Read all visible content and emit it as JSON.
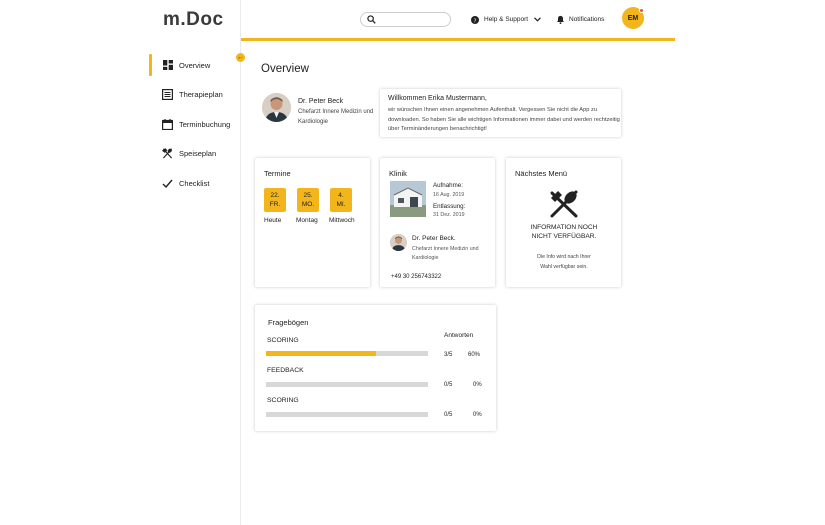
{
  "app": {
    "logo": "m.Doc"
  },
  "sidebar": {
    "items": [
      {
        "label": "Overview",
        "icon": "dashboard-icon",
        "active": true
      },
      {
        "label": "Therapieplan",
        "icon": "list-icon"
      },
      {
        "label": "Terminbuchung",
        "icon": "calendar-icon"
      },
      {
        "label": "Speiseplan",
        "icon": "cutlery-icon"
      },
      {
        "label": "Checklist",
        "icon": "check-icon"
      }
    ],
    "collapse_icon": "arrow-left-icon"
  },
  "header": {
    "search": {
      "placeholder": "",
      "icon": "search-icon"
    },
    "help_label": "Help & Support",
    "notifications_label": "Notifications",
    "avatar_initials": "EM"
  },
  "colors": {
    "accent": "#f2b51b",
    "badge": "#e85040"
  },
  "page": {
    "title": "Overview"
  },
  "doctor": {
    "name": "Dr. Peter Beck",
    "role": "Chefarzt Innere Medizin und Kardiologie"
  },
  "welcome": {
    "title": "Willkommen Erika Mustermann,",
    "text": "wir wünschen Ihnen einen angenehmen Aufenthalt. Vergessen Sie nicht die App zu downloaden. So haben Sie alle wichtigen Informationen immer dabei und werden rechtzeitig über Terminänderungen benachrichtigt!"
  },
  "termine": {
    "title": "Termine",
    "dates": [
      {
        "date": "22.",
        "weekday": "FR.",
        "label": "Heute"
      },
      {
        "date": "25.",
        "weekday": "MO.",
        "label": "Montag"
      },
      {
        "date": "4.",
        "weekday": "MI.",
        "label": "Mittwoch"
      }
    ]
  },
  "klinik": {
    "title": "Klinik",
    "aufnahme_label": "Aufnahme:",
    "aufnahme_date": "16 Aug. 2019",
    "entlassung_label": "Entlassung:",
    "entlassung_date": "31 Dez. 2019",
    "doctor_name": "Dr. Peter Beck.",
    "doctor_role": "Chefarzt Innere Medizin und Kardiologie",
    "phone": "+49 30 256743322"
  },
  "menu": {
    "title": "Nächstes Menü",
    "icon": "cutlery-icon",
    "headline": "INFORMATION NOCH NICHT VERFÜGBAR.",
    "sub": "Die Info wird nach Ihrer Wahl verfügbar sein."
  },
  "fragebogen": {
    "title": "Fragebögen",
    "answers_header": "Antworten",
    "items": [
      {
        "label": "SCORING",
        "answered": "3/5",
        "percent": "60%",
        "progress": 0.68
      },
      {
        "label": "FEEDBACK",
        "answered": "0/5",
        "percent": "0%",
        "progress": 0
      },
      {
        "label": "SCORING",
        "answered": "0/5",
        "percent": "0%",
        "progress": 0
      }
    ]
  }
}
